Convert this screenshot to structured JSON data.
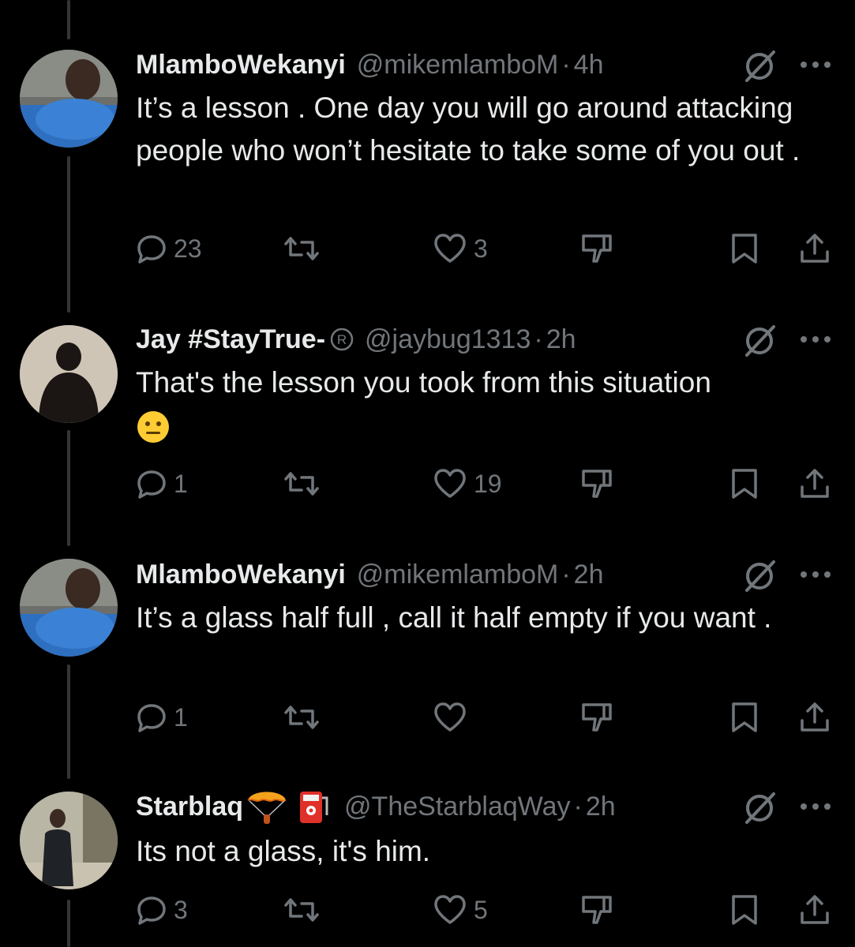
{
  "tweets": [
    {
      "name": "MlamboWekanyi",
      "handle": "@mikemlamboM",
      "dot": "·",
      "time": "4h",
      "text": "It’s a lesson . One day you will go around attacking people who won’t hesitate to take some of you out .",
      "replies": "23",
      "retweets": "",
      "likes": "3"
    },
    {
      "name": "Jay #StayTrue-",
      "handle": "@jaybug1313",
      "dot": "·",
      "time": "2h",
      "text": "That's the lesson you took from this situation",
      "emoji": "neutral-face-emoji",
      "replies": "1",
      "retweets": "",
      "likes": "19"
    },
    {
      "name": "MlamboWekanyi",
      "handle": "@mikemlamboM",
      "dot": "·",
      "time": "2h",
      "text": "It’s a glass half full , call it half empty if you want .",
      "replies": "1",
      "retweets": "",
      "likes": ""
    },
    {
      "name": "Starblaq",
      "handle": "@TheStarblaqWay",
      "dot": "·",
      "time": "2h",
      "text": "Its not a glass, it's him.",
      "name_emojis": [
        "parachute-emoji",
        "fuel-pump-emoji"
      ],
      "replies": "3",
      "retweets": "",
      "likes": "5"
    }
  ],
  "colors": {
    "background": "#000000",
    "text": "#e7e9ea",
    "muted": "#71767b",
    "line": "#333639"
  }
}
